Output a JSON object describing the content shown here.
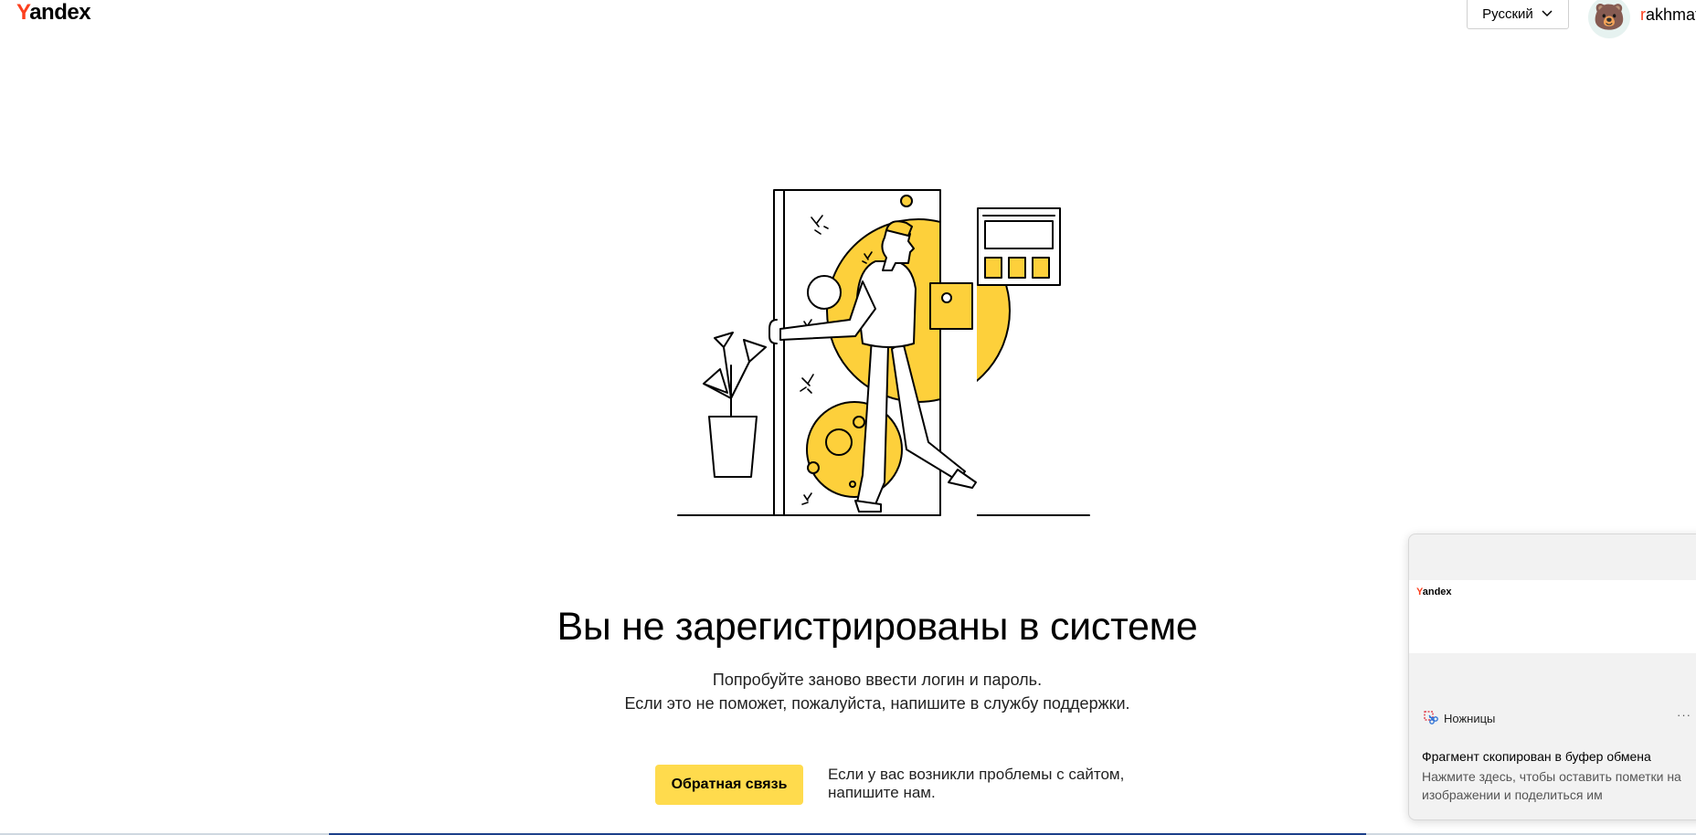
{
  "header": {
    "logo_first_letter": "Y",
    "logo_rest": "andex",
    "language_label": "Русский",
    "username_first": "r",
    "username_rest": "akhmat",
    "avatar_emoji": "🐻"
  },
  "main": {
    "headline": "Вы не зарегистрированы в системе",
    "sub_line1": "Попробуйте заново ввести логин и пароль.",
    "sub_line2": "Если это не поможет, пожалуйста, напишите в службу поддержки.",
    "feedback_button": "Обратная связь",
    "feedback_note_line1": "Если у вас возникли проблемы с сайтом,",
    "feedback_note_line2": "напишите нам."
  },
  "toast": {
    "preview_logo_first": "Y",
    "preview_logo_rest": "andex",
    "app_name": "Ножницы",
    "more": "···",
    "title": "Фрагмент скопирован в буфер обмена",
    "body_line1": "Нажмите здесь, чтобы оставить пометки на",
    "body_line2": "изображении и поделиться им"
  },
  "colors": {
    "brand_red": "#fc3f1d",
    "accent_yellow": "#ffdb4d",
    "illustration_yellow": "#fdd03b"
  }
}
